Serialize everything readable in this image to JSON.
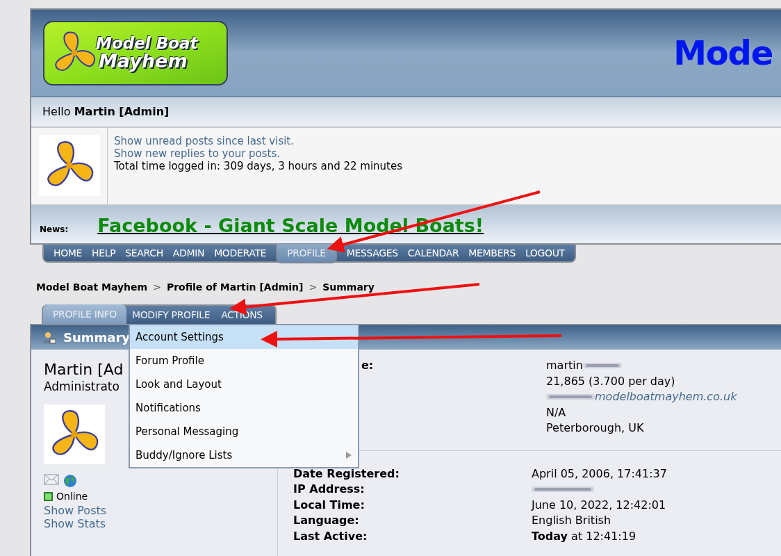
{
  "logo": {
    "line_1": "Model Boat",
    "line_2": "Mayhem"
  },
  "banner_title": "Mode",
  "greeting": {
    "prefix": "Hello",
    "name": "Martin [Admin]"
  },
  "links": [
    "Show unread posts since last visit.",
    "Show new replies to your posts."
  ],
  "time_logged": "Total time logged in: 309 days, 3 hours and 22 minutes",
  "news": {
    "label": "News:",
    "headline": "Facebook - Giant Scale Model Boats!"
  },
  "nav": [
    {
      "label": "HOME",
      "selected": false
    },
    {
      "label": "HELP",
      "selected": false
    },
    {
      "label": "SEARCH",
      "selected": false
    },
    {
      "label": "ADMIN",
      "selected": false
    },
    {
      "label": "MODERATE",
      "selected": false
    },
    {
      "label": "PROFILE",
      "selected": true
    },
    {
      "label": "MESSAGES",
      "selected": false
    },
    {
      "label": "CALENDAR",
      "selected": false
    },
    {
      "label": "MEMBERS",
      "selected": false
    },
    {
      "label": "LOGOUT",
      "selected": false
    }
  ],
  "breadcrumb": {
    "separator": ">",
    "items": [
      "Model Boat Mayhem",
      "Profile of Martin [Admin]",
      "Summary"
    ]
  },
  "profile_tabs": [
    {
      "label": "PROFILE INFO",
      "selected": true
    },
    {
      "label": "MODIFY PROFILE",
      "selected": false
    },
    {
      "label": "ACTIONS",
      "selected": false
    }
  ],
  "menu": [
    {
      "label": "Account Settings",
      "selected": true,
      "submenu": false
    },
    {
      "label": "Forum Profile",
      "selected": false,
      "submenu": false
    },
    {
      "label": "Look and Layout",
      "selected": false,
      "submenu": false
    },
    {
      "label": "Notifications",
      "selected": false,
      "submenu": false
    },
    {
      "label": "Personal Messaging",
      "selected": false,
      "submenu": false
    },
    {
      "label": "Buddy/Ignore Lists",
      "selected": false,
      "submenu": true
    }
  ],
  "summary": {
    "title": "Summary",
    "name": "Martin [Ad",
    "role": "Administrato",
    "status": "Online",
    "online": true,
    "links": [
      "Show Posts",
      "Show Stats"
    ]
  },
  "details": [
    {
      "label": "e:",
      "value": "martin",
      "kind": "text",
      "redacted": true
    },
    {
      "value": "21,865 (3.700 per day)",
      "kind": "text"
    },
    {
      "value": "modelboatmayhem.co.uk",
      "kind": "link",
      "redacted": true
    },
    {
      "value": "N/A",
      "kind": "text"
    },
    {
      "value": "Peterborough, UK",
      "kind": "text"
    }
  ],
  "details_2": [
    {
      "label": "Date Registered:",
      "value": "April 05, 2006, 17:41:37"
    },
    {
      "label": "IP Address:",
      "redacted": true
    },
    {
      "label": "Local Time:",
      "value": "June 10, 2022, 12:42:01"
    },
    {
      "label": "Language:",
      "value": "English British"
    },
    {
      "label": "Last Active:",
      "value": "**Today** at 12:41:19"
    }
  ]
}
